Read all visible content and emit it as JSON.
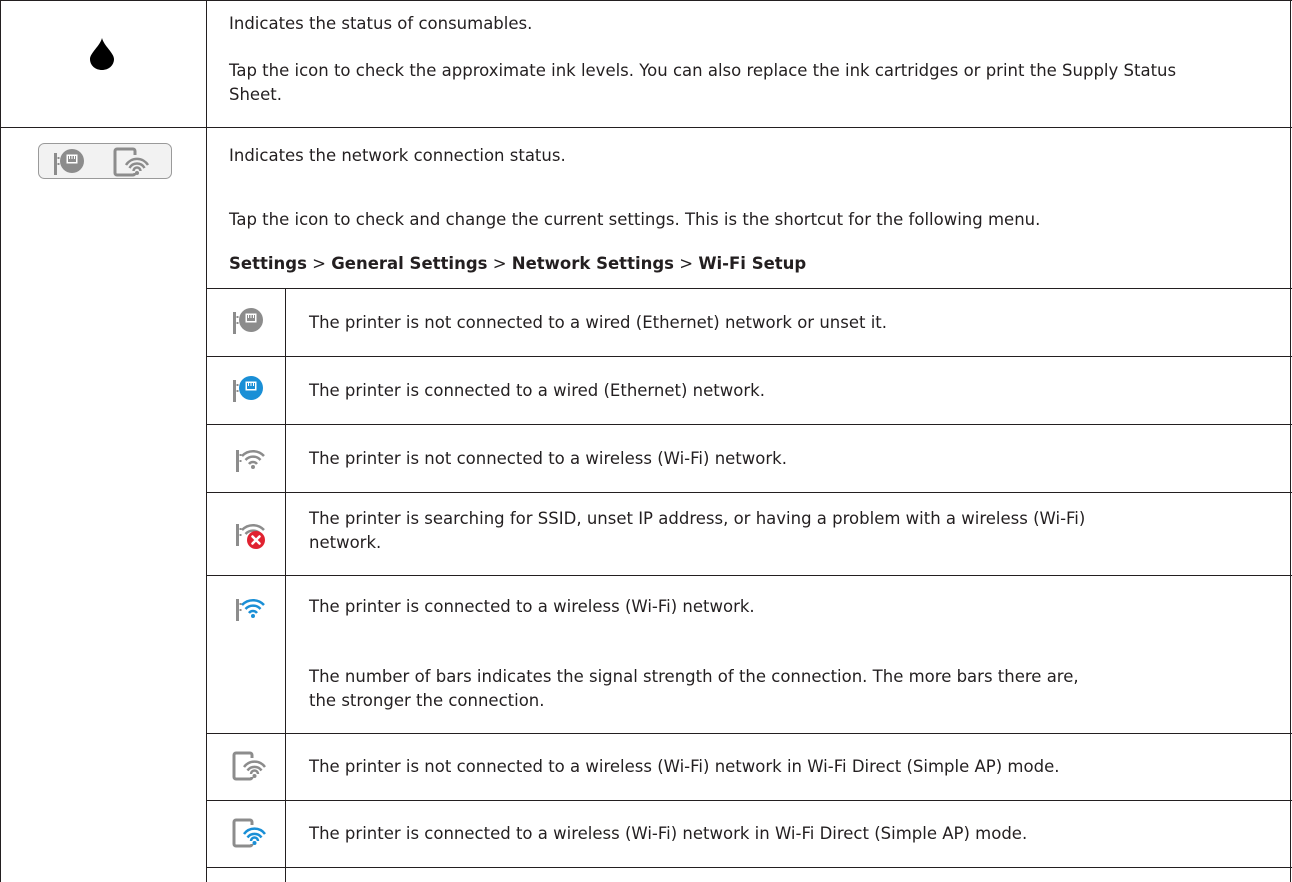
{
  "consumables_row": {
    "icon": "ink-drop-icon",
    "title": "Indicates the status of consumables.",
    "description": "Tap the icon to check the approximate ink levels. You can also replace the ink cartridges or print the Supply Status Sheet."
  },
  "network_row": {
    "icon": "network-status-icons",
    "title": "Indicates the network connection status.",
    "description": "Tap the icon to check and change the current settings. This is the shortcut for the following menu.",
    "menu_path": {
      "items": [
        "Settings",
        "General Settings",
        "Network Settings",
        "Wi-Fi Setup"
      ],
      "separator": ">"
    },
    "status_items": [
      {
        "icon": "ethernet-disconnected-icon",
        "text": "The printer is not connected to a wired (Ethernet) network or unset it."
      },
      {
        "icon": "ethernet-connected-icon",
        "text": "The printer is connected to a wired (Ethernet) network."
      },
      {
        "icon": "wifi-disconnected-icon",
        "text": "The printer is not connected to a wireless (Wi-Fi) network."
      },
      {
        "icon": "wifi-error-icon",
        "text": "The printer is searching for SSID, unset IP address, or having a problem with a wireless (Wi-Fi) network."
      },
      {
        "icon": "wifi-connected-icon",
        "text": "The printer is connected to a wireless (Wi-Fi) network.",
        "note": "The number of bars indicates the signal strength of the connection. The more bars there are, the stronger the connection."
      },
      {
        "icon": "wifi-direct-disconnected-icon",
        "text": "The printer is not connected to a wireless (Wi-Fi) network in Wi-Fi Direct (Simple AP) mode."
      },
      {
        "icon": "wifi-direct-connected-icon",
        "text": "The printer is connected to a wireless (Wi-Fi) network in Wi-Fi Direct (Simple AP) mode."
      }
    ]
  },
  "colors": {
    "gray": "#8c8c8c",
    "blue": "#1a8fd6",
    "red": "#e02230",
    "ink": "#000000",
    "border": "#231f20"
  }
}
